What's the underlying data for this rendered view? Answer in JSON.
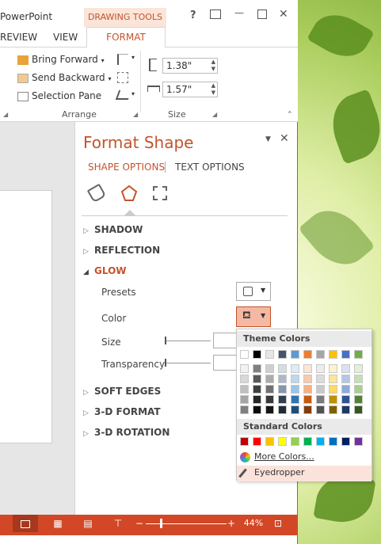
{
  "window": {
    "title": "PowerPoint",
    "context_tab": "DRAWING TOOLS",
    "help": "?",
    "minimize": "—",
    "close": "✕"
  },
  "tabs": {
    "review": "REVIEW",
    "view": "VIEW",
    "format": "FORMAT"
  },
  "ribbon": {
    "arrange": {
      "bring_forward": "Bring Forward",
      "send_backward": "Send Backward",
      "selection_pane": "Selection Pane",
      "label": "Arrange"
    },
    "size": {
      "height": "1.38\"",
      "width": "1.57\"",
      "label": "Size"
    }
  },
  "pane": {
    "title": "Format Shape",
    "tab_shape": "SHAPE OPTIONS",
    "tab_text": "TEXT OPTIONS",
    "sections": {
      "shadow": "SHADOW",
      "reflection": "REFLECTION",
      "glow": "GLOW",
      "soft_edges": "SOFT EDGES",
      "format3d": "3-D FORMAT",
      "rotation3d": "3-D ROTATION"
    },
    "glow": {
      "presets": "Presets",
      "color": "Color",
      "size": "Size",
      "transparency": "Transparency"
    }
  },
  "colors": {
    "accent": "#d24726",
    "theme_top": [
      "#ffffff",
      "#000000",
      "#e7e6e6",
      "#44546a",
      "#5b9bd5",
      "#ed7d31",
      "#a5a5a5",
      "#ffc000",
      "#4472c4",
      "#70ad47"
    ],
    "theme_shades": [
      [
        "#f2f2f2",
        "#7f7f7f",
        "#d0cece",
        "#d6dce4",
        "#deebf6",
        "#fbe5d5",
        "#ededed",
        "#fff2cc",
        "#d9e2f3",
        "#e2efd9"
      ],
      [
        "#d8d8d8",
        "#595959",
        "#aeabab",
        "#adb9ca",
        "#bdd7ee",
        "#f7cbac",
        "#dbdbdb",
        "#fee599",
        "#b4c6e7",
        "#c5e0b3"
      ],
      [
        "#bfbfbf",
        "#3f3f3f",
        "#757070",
        "#8496b0",
        "#9dc3e6",
        "#f4b183",
        "#c9c9c9",
        "#ffd965",
        "#8eaadb",
        "#a8d08d"
      ],
      [
        "#a5a5a5",
        "#262626",
        "#3a3838",
        "#323f4f",
        "#2e75b5",
        "#c55a11",
        "#7b7b7b",
        "#bf9000",
        "#2f5496",
        "#538135"
      ],
      [
        "#7f7f7f",
        "#0c0c0c",
        "#171616",
        "#222a35",
        "#1e4e79",
        "#833c0b",
        "#525252",
        "#7f6000",
        "#1f3864",
        "#375623"
      ]
    ],
    "standard": [
      "#c00000",
      "#ff0000",
      "#ffc000",
      "#ffff00",
      "#92d050",
      "#00b050",
      "#00b0f0",
      "#0070c0",
      "#002060",
      "#7030a0"
    ]
  },
  "color_menu": {
    "theme_colors": "Theme Colors",
    "standard_colors": "Standard Colors",
    "more_colors": "More Colors...",
    "eyedropper": "Eyedropper"
  },
  "status": {
    "zoom": "44%"
  }
}
